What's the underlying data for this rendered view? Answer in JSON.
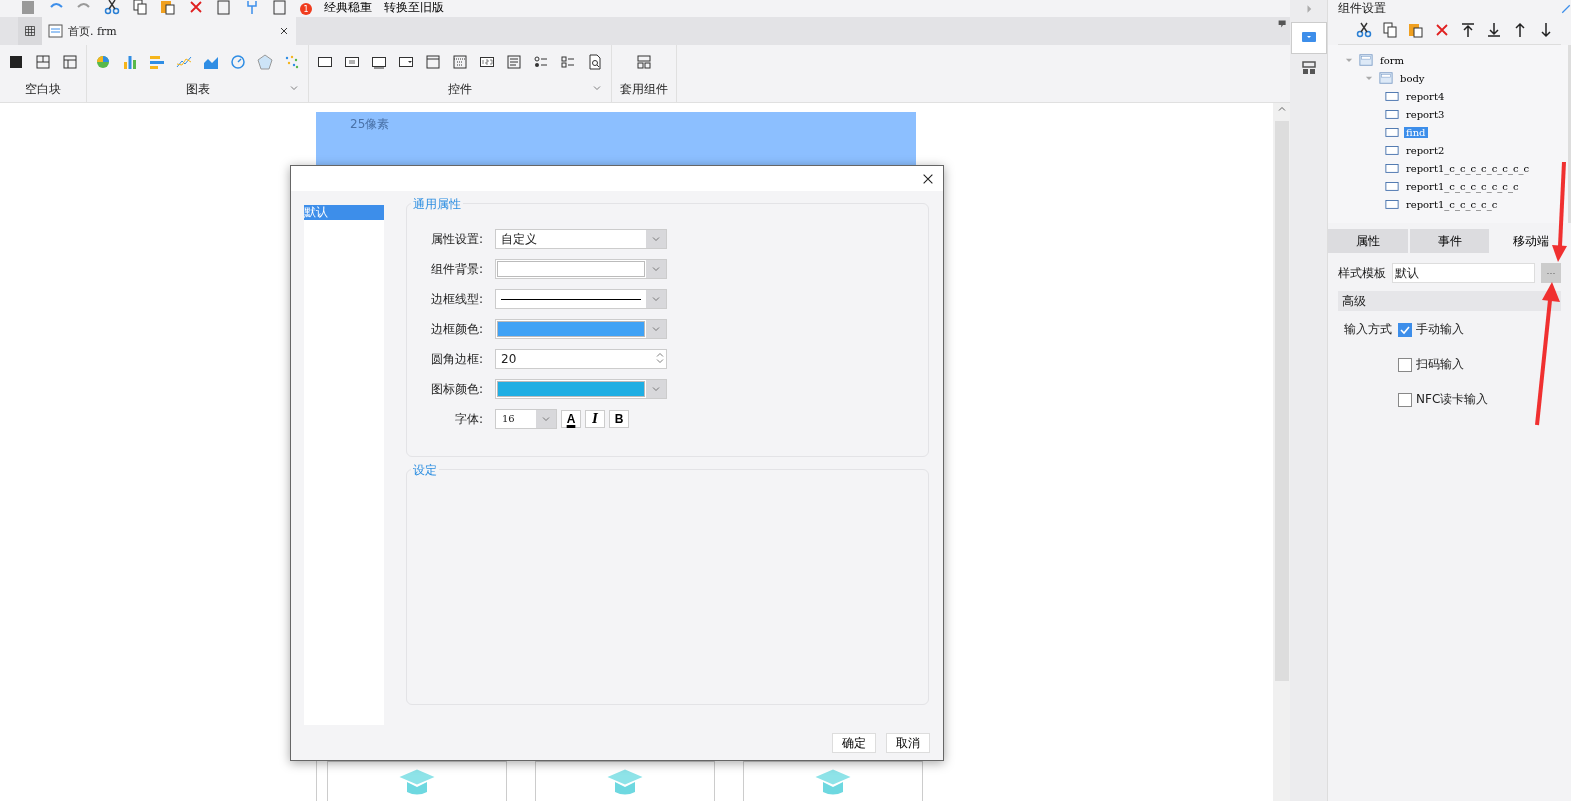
{
  "toolbar": {
    "badge": "1",
    "buttons": [
      {
        "label": "经典稳重"
      },
      {
        "label": "转换至旧版"
      }
    ]
  },
  "file_tab": {
    "title": "首页. frm"
  },
  "ribbon": {
    "groups": [
      {
        "label": "空白块",
        "kind": "plain"
      },
      {
        "label": "图表",
        "kind": "dropdown"
      },
      {
        "label": "控件",
        "kind": "dropdown"
      },
      {
        "label": "套用组件",
        "kind": "plain"
      }
    ]
  },
  "canvas": {
    "label": "25像素"
  },
  "dialog": {
    "sidebar": [
      {
        "label": "默认",
        "selected": true
      }
    ],
    "general": {
      "title": "通用属性",
      "rows": [
        {
          "label": "属性设置:",
          "kind": "select",
          "value": "自定义"
        },
        {
          "label": "组件背景:",
          "kind": "color",
          "color": "#ffffff"
        },
        {
          "label": "边框线型:",
          "kind": "line"
        },
        {
          "label": "边框颜色:",
          "kind": "color",
          "color": "#3fa2f5"
        },
        {
          "label": "圆角边框:",
          "kind": "number",
          "value": "20"
        },
        {
          "label": "图标颜色:",
          "kind": "color",
          "color": "#1faee3"
        },
        {
          "label": "字体:",
          "kind": "font",
          "value": "16",
          "format_buttons": [
            "A",
            "I",
            "B"
          ]
        }
      ]
    },
    "settings": {
      "title": "设定"
    },
    "buttons": [
      "确定",
      "取消"
    ]
  },
  "right_panel": {
    "title": "组件设置",
    "tree": [
      {
        "label": "form",
        "selected": false,
        "children": [
          {
            "label": "body",
            "selected": false,
            "children": [
              {
                "label": "report4",
                "selected": false
              },
              {
                "label": "report3",
                "selected": false
              },
              {
                "label": "find",
                "selected": true
              },
              {
                "label": "report2",
                "selected": false
              },
              {
                "label": "report1_c_c_c_c_c_c_c_c",
                "selected": false
              },
              {
                "label": "report1_c_c_c_c_c_c_c",
                "selected": false
              },
              {
                "label": "report1_c_c_c_c_c",
                "selected": false
              }
            ]
          }
        ]
      }
    ],
    "tabs": [
      {
        "label": "属性",
        "selected": false
      },
      {
        "label": "事件",
        "selected": false
      },
      {
        "label": "移动端",
        "selected": true
      }
    ],
    "style_template": {
      "label": "样式模板",
      "value": "默认",
      "button": "···"
    },
    "section": {
      "title": "高级"
    },
    "input_mode": {
      "label": "输入方式",
      "options": [
        {
          "label": "手动输入",
          "checked": true
        },
        {
          "label": "扫码输入",
          "checked": false
        },
        {
          "label": "NFC读卡输入",
          "checked": false
        }
      ]
    }
  }
}
